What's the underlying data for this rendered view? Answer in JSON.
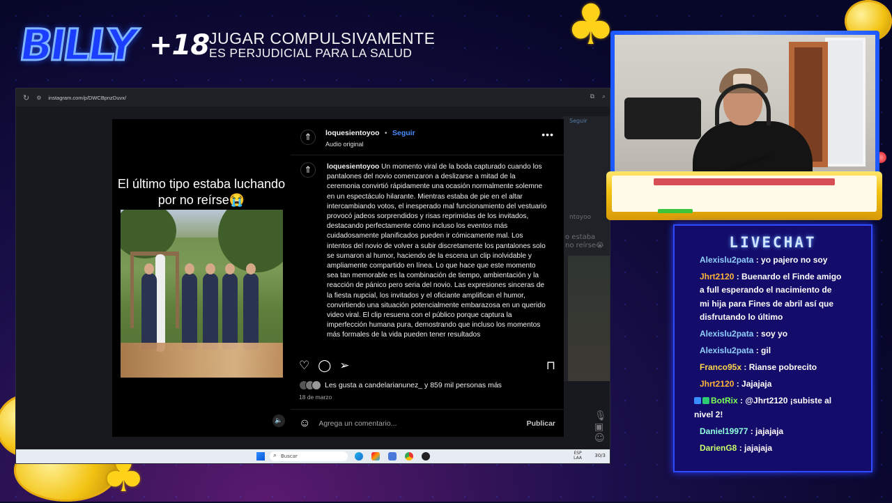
{
  "brand": {
    "logo_text": "BILLY",
    "age_label": "+18",
    "warning_line1": "JUGAR COMPULSIVAMENTE",
    "warning_line2": "ES PERJUDICIAL PARA LA SALUD"
  },
  "browser": {
    "url": "instagram.com/p/DWCBpnzDuvx/"
  },
  "background_page": {
    "follow_label": "Seguir",
    "time_ago": "14 min",
    "username_partial": "ntoyoo",
    "caption_partial": "o estaba\nno reírse😭"
  },
  "post": {
    "overlay_caption": "El último tipo estaba luchando por no reírse😭",
    "author": "loquesientoyoo",
    "follow": "Seguir",
    "audio": "Audio original",
    "caption_author": "loquesientoyoo",
    "caption_text": "Un momento viral de la boda capturado cuando los pantalones del novio comenzaron a deslizarse a mitad de la ceremonia convirtió rápidamente una ocasión normalmente solemne en un espectáculo hilarante. Mientras estaba de pie en el altar intercambiando votos, el inesperado mal funcionamiento del vestuario provocó jadeos sorprendidos y risas reprimidas de los invitados, destacando perfectamente cómo incluso los eventos más cuidadosamente planificados pueden ir cómicamente mal. Los intentos del novio de volver a subir discretamente los pantalones solo se sumaron al humor, haciendo de la escena un clip inolvidable y ampliamente compartido en línea. Lo que hace que este momento sea tan memorable es la combinación de tiempo, ambientación y la reacción de pánico pero seria del novio. Las expresiones sinceras de la fiesta nupcial, los invitados y el oficiante amplifican el humor, convirtiendo una situación potencialmente embarazosa en un querido video viral. El clip resuena con el público porque captura la imperfección humana pura, demostrando que incluso los momentos más formales de la vida pueden tener resultados",
    "likes": "Les gusta a candelarianunez_ y 859 mil personas más",
    "date": "18 de marzo",
    "comment_placeholder": "Agrega un comentario...",
    "publish": "Publicar"
  },
  "taskbar": {
    "search_placeholder": "Buscar",
    "lang_top": "ESP",
    "lang_bottom": "LAA",
    "date_partial": "30/3"
  },
  "chat": {
    "title": "LIVECHAT",
    "messages": [
      {
        "user": "Alexislu2pata",
        "user_color": "#8fd0ff",
        "text": " : yo pajero no soy"
      },
      {
        "user": "Jhrt2120",
        "user_color": "#ffb43c",
        "text": " : Buenardo el Finde amigo a full esperando el nacimiento de mi hija para Fines de abril así que disfrutando lo último"
      },
      {
        "user": "Alexislu2pata",
        "user_color": "#8fd0ff",
        "text": " : soy yo"
      },
      {
        "user": "Alexislu2pata",
        "user_color": "#8fd0ff",
        "text": " : gil"
      },
      {
        "user": "Franco95x",
        "user_color": "#ffd64a",
        "text": " : Rianse pobrecito"
      },
      {
        "user": "Jhrt2120",
        "user_color": "#ffb43c",
        "text": " : Jajajaja"
      },
      {
        "user": "BotRix",
        "user_color": "#7cff5a",
        "text": " : @Jhrt2120 ¡subiste al nivel 2!"
      },
      {
        "user": "Daniel19977",
        "user_color": "#8fffe0",
        "text": " : jajajaja"
      },
      {
        "user": "DarienG8",
        "user_color": "#c8ff6a",
        "text": " : jajajaja"
      }
    ]
  },
  "colors": {
    "accent_blue": "#2e4bff",
    "gold": "#f2c313",
    "instagram_link": "#4a8cff"
  }
}
